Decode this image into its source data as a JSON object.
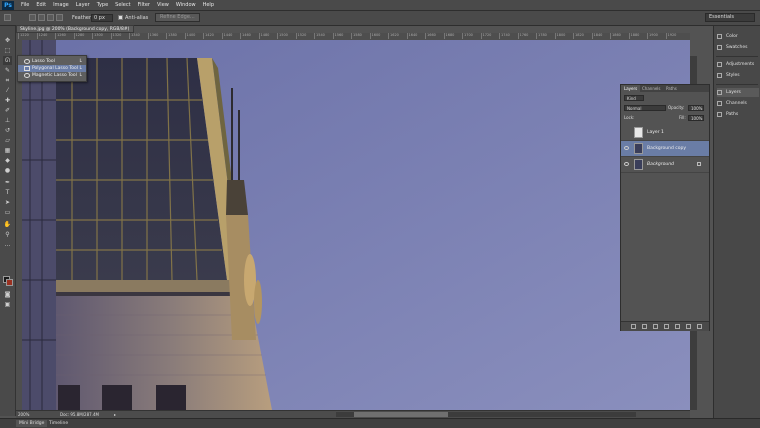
{
  "app": {
    "logo": "Ps"
  },
  "menu": [
    "File",
    "Edit",
    "Image",
    "Layer",
    "Type",
    "Select",
    "Filter",
    "View",
    "Window",
    "Help"
  ],
  "options": {
    "feather_label": "Feather:",
    "feather_value": "0 px",
    "anti_alias_label": "Anti-alias",
    "anti_alias_checked": true,
    "refine_edge_label": "Refine Edge...",
    "workspace": "Essentials"
  },
  "document": {
    "tab_title": "Skyline.jpg @ 200% (Background copy, RGB/8#) *",
    "zoom": "200%",
    "doc_size": "Doc: 95.8M/287.4M"
  },
  "ruler_ticks": [
    "1220",
    "1240",
    "1260",
    "1280",
    "1300",
    "1320",
    "1340",
    "1360",
    "1380",
    "1400",
    "1420",
    "1440",
    "1460",
    "1480",
    "1500",
    "1520",
    "1540",
    "1560",
    "1580",
    "1600",
    "1620",
    "1640",
    "1660",
    "1680",
    "1700",
    "1720",
    "1740",
    "1760",
    "1780",
    "1800",
    "1820",
    "1840",
    "1860",
    "1880",
    "1900",
    "1920"
  ],
  "lasso_flyout": [
    {
      "label": "Lasso Tool",
      "key": "L",
      "active": false
    },
    {
      "label": "Polygonal Lasso Tool",
      "key": "L",
      "active": true
    },
    {
      "label": "Magnetic Lasso Tool",
      "key": "L",
      "active": false
    }
  ],
  "dock": {
    "group1": [
      "Color",
      "Swatches"
    ],
    "group2": [
      "Adjustments",
      "Styles"
    ],
    "group3": [
      "Layers",
      "Channels",
      "Paths"
    ]
  },
  "layers_panel": {
    "tabs": [
      "Layers",
      "Channels",
      "Paths"
    ],
    "filter": "Kind",
    "blend_mode": "Normal",
    "opacity_label": "Opacity:",
    "opacity": "100%",
    "lock_label": "Lock:",
    "fill_label": "Fill:",
    "fill": "100%",
    "layers": [
      {
        "name": "Layer 1",
        "selected": false,
        "visible": false,
        "locked": false
      },
      {
        "name": "Background copy",
        "selected": true,
        "visible": true,
        "locked": false
      },
      {
        "name": "Background",
        "selected": false,
        "visible": true,
        "locked": true
      }
    ]
  },
  "bottom_tabs": [
    "Mini Bridge",
    "Timeline"
  ],
  "colors": {
    "sky": "#7a81b2",
    "selection": "#6a7da6",
    "foreground": "#1a1a1a",
    "background": "#9a3020"
  }
}
